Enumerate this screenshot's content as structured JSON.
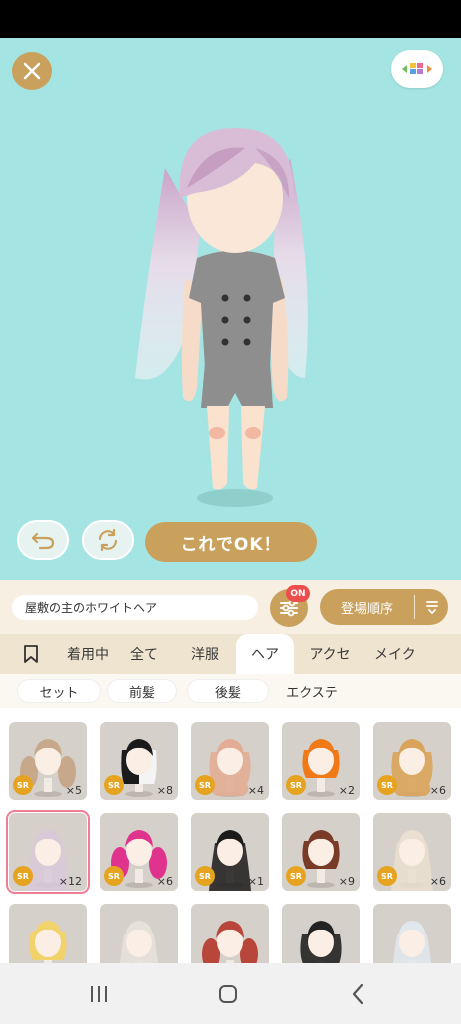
{
  "header": {
    "close_icon": "close-icon",
    "menu_icon": "color-palette-icon"
  },
  "actions": {
    "undo_icon": "undo-icon",
    "rotate_icon": "rotate-icon",
    "ok_label": "これでOK！"
  },
  "filter_bar": {
    "item_name": "屋敷の主のホワイトヘア",
    "filter_badge": "ON",
    "sort_label": "登場順序"
  },
  "tabs": [
    {
      "label": "",
      "icon": "bookmark-icon"
    },
    {
      "label": "着用中"
    },
    {
      "label": "全て"
    },
    {
      "label": "洋服"
    },
    {
      "label": "ヘア",
      "active": true
    },
    {
      "label": "アクセ"
    },
    {
      "label": "メイク"
    }
  ],
  "subtabs": [
    {
      "label": "セット",
      "selected": true
    },
    {
      "label": "前髪",
      "selected": true
    },
    {
      "label": "後髪",
      "selected": true
    },
    {
      "label": "エクステ",
      "selected": false
    }
  ],
  "items": [
    {
      "rarity": "SR",
      "count": "×5",
      "hair": "#c8a88a",
      "style": "twin"
    },
    {
      "rarity": "SR",
      "count": "×8",
      "hair": "#1b1b1b",
      "style": "split"
    },
    {
      "rarity": "SR",
      "count": "×4",
      "hair": "#e3ad95",
      "style": "wavy"
    },
    {
      "rarity": "SR",
      "count": "×2",
      "hair": "#f07a18",
      "style": "bob"
    },
    {
      "rarity": "SR",
      "count": "×6",
      "hair": "#d9a45a",
      "style": "wavy"
    },
    {
      "rarity": "SR",
      "count": "×12",
      "hair": "#d8c9d8",
      "style": "long",
      "selected": true
    },
    {
      "rarity": "SR",
      "count": "×6",
      "hair": "#e0338e",
      "style": "twin"
    },
    {
      "rarity": "SR",
      "count": "×1",
      "hair": "#1a1a1a",
      "style": "long"
    },
    {
      "rarity": "SR",
      "count": "×9",
      "hair": "#7a3a28",
      "style": "bob"
    },
    {
      "rarity": "SR",
      "count": "×6",
      "hair": "#eadfd0",
      "style": "long"
    },
    {
      "rarity": "",
      "count": "",
      "hair": "#f2d26a",
      "style": "bob"
    },
    {
      "rarity": "",
      "count": "",
      "hair": "#e6e2da",
      "style": "long"
    },
    {
      "rarity": "",
      "count": "",
      "hair": "#b8463a",
      "style": "twin"
    },
    {
      "rarity": "",
      "count": "",
      "hair": "#222222",
      "style": "wavy"
    },
    {
      "rarity": "",
      "count": "",
      "hair": "#e0e8ee",
      "style": "long"
    }
  ],
  "colors": {
    "accent": "#c9a15c",
    "stage_bg": "#a4e5e3",
    "badge_red": "#ec4d4d",
    "rarity_gold": "#e6a320",
    "selected_outline": "#ef7d95"
  },
  "navbar": {
    "recent_icon": "recent-apps-icon",
    "home_icon": "home-icon",
    "back_icon": "back-icon"
  }
}
